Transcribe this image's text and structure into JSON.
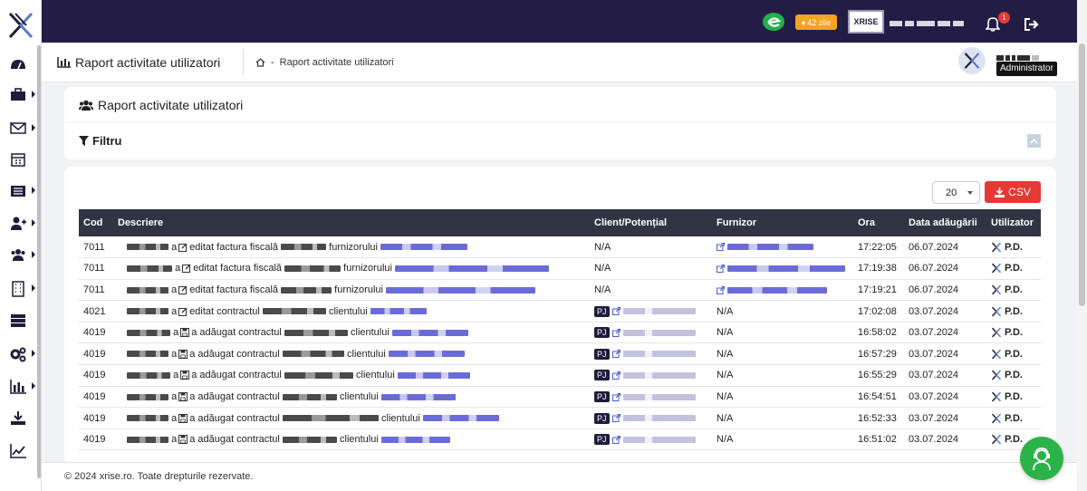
{
  "colors": {
    "topbar": "#231d45",
    "accent": "#e53935",
    "badge": "#f5a322",
    "table_header": "#303443",
    "pj_badge": "#1e1d3c",
    "chat": "#2bb34a"
  },
  "sidebar": {
    "icons": [
      "dashboard-icon",
      "briefcase-icon",
      "envelope-icon",
      "calendar-icon",
      "list-icon",
      "user-plus-icon",
      "users-icon",
      "building-icon",
      "server-icon",
      "cogs-icon",
      "bar-chart-icon",
      "download-icon",
      "line-chart-icon"
    ]
  },
  "topbar": {
    "days_label": "42 zile",
    "brand": "XRISE",
    "notifications_count": "1"
  },
  "page_header": {
    "title": "Raport activitate utilizatori",
    "breadcrumb": "Raport activitate utilizatori",
    "role": "Administrator"
  },
  "card": {
    "title": "Raport activitate utilizatori",
    "filter_label": "Filtru"
  },
  "table": {
    "per_page": "20",
    "csv_label": "CSV",
    "columns": [
      "Cod",
      "Descriere",
      "Client/Potențial",
      "Furnizor",
      "Ora",
      "Data adăugării",
      "Utilizator"
    ],
    "rows": [
      {
        "cod": "7011",
        "a": "a",
        "action": "editat factura fiscală",
        "target": "furnizorului",
        "client": "N/A",
        "furnizor": "link",
        "ora": "17:22:05",
        "data": "06.07.2024",
        "user": "P.D."
      },
      {
        "cod": "7011",
        "a": "a",
        "action": "editat factura fiscală",
        "target": "furnizorului",
        "client": "N/A",
        "furnizor": "link",
        "ora": "17:19:38",
        "data": "06.07.2024",
        "user": "P.D."
      },
      {
        "cod": "7011",
        "a": "a",
        "action": "editat factura fiscală",
        "target": "furnizorului",
        "client": "N/A",
        "furnizor": "link",
        "ora": "17:19:21",
        "data": "06.07.2024",
        "user": "P.D."
      },
      {
        "cod": "4021",
        "a": "a",
        "action": "editat contractul",
        "target": "clientului",
        "client": "PJ",
        "furnizor": "N/A",
        "ora": "17:02:08",
        "data": "03.07.2024",
        "user": "P.D."
      },
      {
        "cod": "4019",
        "a": "a",
        "action": "a adăugat contractul",
        "target": "clientului",
        "client": "PJ",
        "furnizor": "N/A",
        "ora": "16:58:02",
        "data": "03.07.2024",
        "user": "P.D."
      },
      {
        "cod": "4019",
        "a": "a",
        "action": "a adăugat contractul",
        "target": "clientului",
        "client": "PJ",
        "furnizor": "N/A",
        "ora": "16:57:29",
        "data": "03.07.2024",
        "user": "P.D."
      },
      {
        "cod": "4019",
        "a": "a",
        "action": "a adăugat contractul",
        "target": "clientului",
        "client": "PJ",
        "furnizor": "N/A",
        "ora": "16:55:29",
        "data": "03.07.2024",
        "user": "P.D."
      },
      {
        "cod": "4019",
        "a": "a",
        "action": "a adăugat contractul",
        "target": "clientului",
        "client": "PJ",
        "furnizor": "N/A",
        "ora": "16:54:51",
        "data": "03.07.2024",
        "user": "P.D."
      },
      {
        "cod": "4019",
        "a": "a",
        "action": "a adăugat contractul",
        "target": "clientului",
        "client": "PJ",
        "furnizor": "N/A",
        "ora": "16:52:33",
        "data": "03.07.2024",
        "user": "P.D."
      },
      {
        "cod": "4019",
        "a": "a",
        "action": "a adăugat contractul",
        "target": "clientului",
        "client": "PJ",
        "furnizor": "N/A",
        "ora": "16:51:02",
        "data": "03.07.2024",
        "user": "P.D."
      }
    ]
  },
  "footer": {
    "text": "© 2024 xrise.ro. Toate drepturile rezervate."
  }
}
